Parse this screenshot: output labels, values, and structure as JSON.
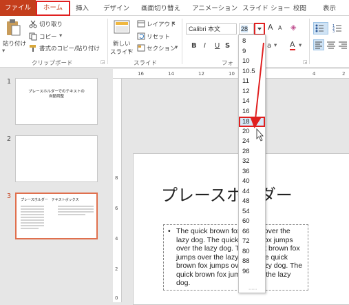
{
  "tabs": {
    "file": "ファイル",
    "home": "ホーム",
    "insert": "挿入",
    "design": "デザイン",
    "transitions": "画面切り替え",
    "animations": "アニメーション",
    "slideshow": "スライド ショー",
    "review": "校閲",
    "view": "表示"
  },
  "ribbon": {
    "clipboard": {
      "paste": "貼り付け",
      "cut": "切り取り",
      "copy": "コピー",
      "format_painter": "書式のコピー/貼り付け",
      "group": "クリップボード"
    },
    "slides": {
      "new_slide_1": "新しい",
      "new_slide_2": "スライド",
      "layout": "レイアウト",
      "reset": "リセット",
      "section": "セクション",
      "group": "スライド"
    },
    "font": {
      "name": "Calibri 本文",
      "size": "28",
      "group": "フォ",
      "bold": "B",
      "italic": "I",
      "underline": "U",
      "strike": "S",
      "grow": "A",
      "shrink": "A",
      "color_a": "A",
      "highlight_a": "a"
    }
  },
  "size_options": [
    "8",
    "9",
    "10",
    "10.5",
    "11",
    "12",
    "14",
    "16",
    "18",
    "20",
    "24",
    "28",
    "32",
    "36",
    "40",
    "44",
    "48",
    "54",
    "60",
    "66",
    "72",
    "80",
    "88",
    "96"
  ],
  "highlighted_size": "18",
  "ruler": {
    "h_16": "16",
    "h_14": "14",
    "h_12": "12",
    "h_10": "10",
    "h_4": "4",
    "h_2": "2",
    "v_8": "8",
    "v_6": "6",
    "v_4": "4",
    "v_2": "2",
    "v_0": "0"
  },
  "thumbnails": [
    {
      "num": "1",
      "title": "プレースホルダーでのテキストの自動調整"
    },
    {
      "num": "2",
      "title": ""
    },
    {
      "num": "3",
      "title": "プレースホルダー　テキストボックス"
    }
  ],
  "slide": {
    "title": "プレースホルダー",
    "body": "The quick brown fox jumps over the lazy dog. The quick brown fox jumps over the lazy dog. The quick brown fox jumps over the lazy dog. The quick brown fox jumps over the lazy dog. The quick brown fox jumps over the lazy dog."
  },
  "colors": {
    "file_tab": "#c43e1c",
    "highlight_box": "#e02020",
    "selected_thumb": "#e0704e",
    "dropdown_hover": "#d7e9f8"
  }
}
